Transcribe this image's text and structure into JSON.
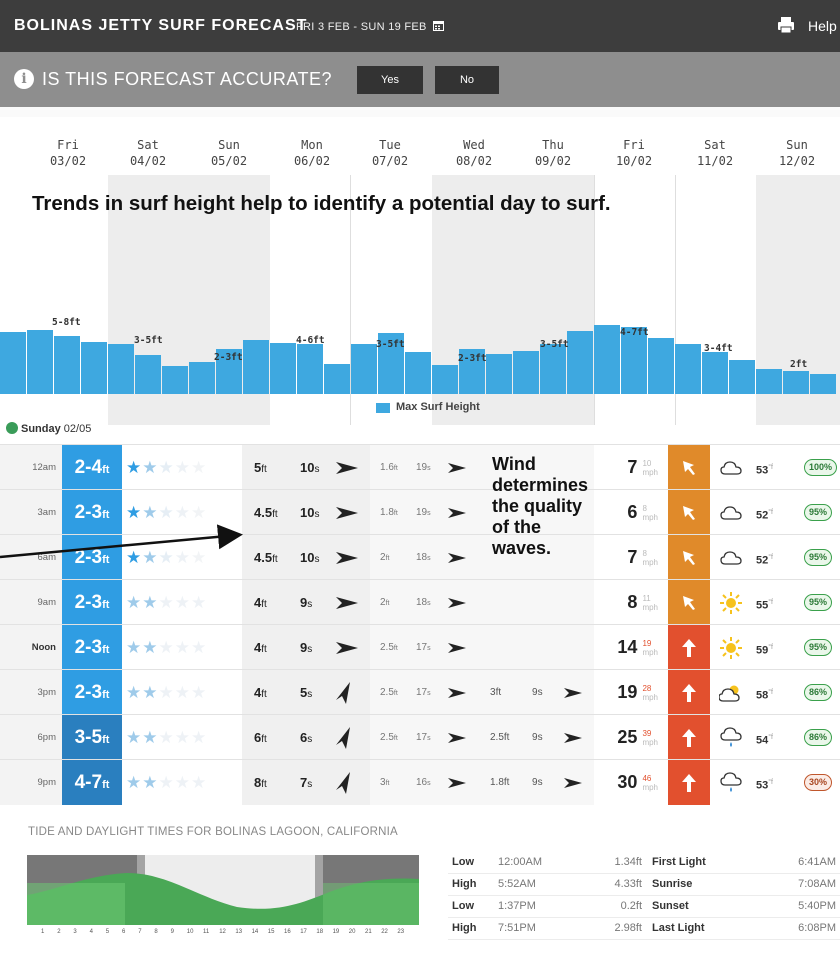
{
  "header": {
    "title": "BOLINAS JETTY SURF FORECAST",
    "date_range": "FRI 3 FEB - SUN 19 FEB",
    "help_label": "Help"
  },
  "accuracy": {
    "question": "IS THIS FORECAST ACCURATE?",
    "yes_label": "Yes",
    "no_label": "No"
  },
  "days": [
    {
      "name": "Fri",
      "date": "03/02"
    },
    {
      "name": "Sat",
      "date": "04/02"
    },
    {
      "name": "Sun",
      "date": "05/02"
    },
    {
      "name": "Mon",
      "date": "06/02"
    },
    {
      "name": "Tue",
      "date": "07/02"
    },
    {
      "name": "Wed",
      "date": "08/02"
    },
    {
      "name": "Thu",
      "date": "09/02"
    },
    {
      "name": "Fri",
      "date": "10/02"
    },
    {
      "name": "Sat",
      "date": "11/02"
    },
    {
      "name": "Sun",
      "date": "12/02"
    }
  ],
  "annotation_surf": "Trends in surf height help to identify a potential day to surf.",
  "annotation_wind": "Wind\ndetermines\nthe quality\nof the\nwaves.",
  "chart_data": {
    "type": "bar",
    "legend": "Max Surf Height",
    "ylabel": "",
    "values": [
      6.6,
      6.8,
      6.2,
      5.5,
      5.3,
      4.2,
      3.0,
      3.4,
      4.8,
      5.7,
      5.4,
      5.3,
      3.2,
      5.3,
      6.5,
      4.5,
      3.1,
      4.8,
      4.3,
      4.6,
      5.3,
      6.7,
      7.3,
      7.1,
      6.0,
      5.3,
      4.5,
      3.6,
      2.7,
      2.5,
      2.1
    ],
    "day_labels": [
      "5-8ft",
      "3-5ft",
      "2-3ft",
      "4-6ft",
      "3-5ft",
      "2-3ft",
      "3-5ft",
      "4-7ft",
      "3-4ft",
      "2ft"
    ]
  },
  "selected_day": {
    "name": "Sunday",
    "date": "02/05"
  },
  "rows": [
    {
      "time": "12am",
      "surf": "2-4",
      "surf_unit": "ft",
      "stars": "★★★★★",
      "primary_height": "5",
      "primary_unit": "ft",
      "primary_period": "10",
      "period_unit": "s",
      "secondary_height": "1.6",
      "secondary_period": "19",
      "tertiary_height": "",
      "tertiary_period": "",
      "wind": "7",
      "gust": "10",
      "wind_unit": "mph",
      "temp": "53",
      "temp_unit": "°f",
      "prob": "100%"
    },
    {
      "time": "3am",
      "surf": "2-3",
      "surf_unit": "ft",
      "stars": "★★★★★",
      "primary_height": "4.5",
      "primary_unit": "ft",
      "primary_period": "10",
      "period_unit": "s",
      "secondary_height": "1.8",
      "secondary_period": "19",
      "tertiary_height": "",
      "tertiary_period": "",
      "wind": "6",
      "gust": "8",
      "wind_unit": "mph",
      "temp": "52",
      "temp_unit": "°f",
      "prob": "95%"
    },
    {
      "time": "6am",
      "surf": "2-3",
      "surf_unit": "ft",
      "stars": "★★★★★",
      "primary_height": "4.5",
      "primary_unit": "ft",
      "primary_period": "10",
      "period_unit": "s",
      "secondary_height": "2",
      "secondary_period": "18",
      "tertiary_height": "",
      "tertiary_period": "",
      "wind": "7",
      "gust": "8",
      "wind_unit": "mph",
      "temp": "52",
      "temp_unit": "°f",
      "prob": "95%"
    },
    {
      "time": "9am",
      "surf": "2-3",
      "surf_unit": "ft",
      "stars": "★★★★★",
      "primary_height": "4",
      "primary_unit": "ft",
      "primary_period": "9",
      "period_unit": "s",
      "secondary_height": "2",
      "secondary_period": "18",
      "tertiary_height": "",
      "tertiary_period": "",
      "wind": "8",
      "gust": "11",
      "wind_unit": "mph",
      "temp": "55",
      "temp_unit": "°f",
      "prob": "95%"
    },
    {
      "time": "Noon",
      "surf": "2-3",
      "surf_unit": "ft",
      "stars": "★★★★★",
      "primary_height": "4",
      "primary_unit": "ft",
      "primary_period": "9",
      "period_unit": "s",
      "secondary_height": "2.5",
      "secondary_period": "17",
      "tertiary_height": "",
      "tertiary_period": "",
      "wind": "14",
      "gust": "19",
      "wind_unit": "mph",
      "temp": "59",
      "temp_unit": "°f",
      "prob": "95%"
    },
    {
      "time": "3pm",
      "surf": "2-3",
      "surf_unit": "ft",
      "stars": "★★★★★",
      "primary_height": "4",
      "primary_unit": "ft",
      "primary_period": "5",
      "period_unit": "s",
      "secondary_height": "2.5",
      "secondary_period": "17",
      "tertiary_height": "3",
      "tertiary_period": "9",
      "wind": "19",
      "gust": "28",
      "wind_unit": "mph",
      "temp": "58",
      "temp_unit": "°f",
      "prob": "86%"
    },
    {
      "time": "6pm",
      "surf": "3-5",
      "surf_unit": "ft",
      "stars": "★★★★★",
      "primary_height": "6",
      "primary_unit": "ft",
      "primary_period": "6",
      "period_unit": "s",
      "secondary_height": "2.5",
      "secondary_period": "17",
      "tertiary_height": "2.5",
      "tertiary_period": "9",
      "wind": "25",
      "gust": "39",
      "wind_unit": "mph",
      "temp": "54",
      "temp_unit": "°f",
      "prob": "86%"
    },
    {
      "time": "9pm",
      "surf": "4-7",
      "surf_unit": "ft",
      "stars": "★★★★★",
      "primary_height": "8",
      "primary_unit": "ft",
      "primary_period": "7",
      "period_unit": "s",
      "secondary_height": "3",
      "secondary_period": "16",
      "tertiary_height": "1.8",
      "tertiary_period": "9",
      "wind": "30",
      "gust": "46",
      "wind_unit": "mph",
      "temp": "53",
      "temp_unit": "°f",
      "prob": "30%"
    }
  ],
  "tide": {
    "title": "TIDE AND DAYLIGHT TIMES FOR BOLINAS LAGOON, CALIFORNIA",
    "hours": [
      "1",
      "2",
      "3",
      "4",
      "5",
      "6",
      "7",
      "8",
      "9",
      "10",
      "11",
      "12",
      "13",
      "14",
      "15",
      "16",
      "17",
      "18",
      "19",
      "20",
      "21",
      "22",
      "23"
    ],
    "tides": [
      {
        "type": "Low",
        "time": "12:00AM",
        "height": "1.34ft"
      },
      {
        "type": "High",
        "time": "5:52AM",
        "height": "4.33ft"
      },
      {
        "type": "Low",
        "time": "1:37PM",
        "height": "0.2ft"
      },
      {
        "type": "High",
        "time": "7:51PM",
        "height": "2.98ft"
      }
    ],
    "daylight": [
      {
        "label": "First Light",
        "time": "6:41AM"
      },
      {
        "label": "Sunrise",
        "time": "7:08AM"
      },
      {
        "label": "Sunset",
        "time": "5:40PM"
      },
      {
        "label": "Last Light",
        "time": "6:08PM"
      }
    ]
  },
  "colors": {
    "surf": "#2f9de3",
    "wind_light": "#e08a2a",
    "wind_strong": "#e2502e",
    "bar": "#3ea8e0",
    "header": "#3d3d3d"
  }
}
